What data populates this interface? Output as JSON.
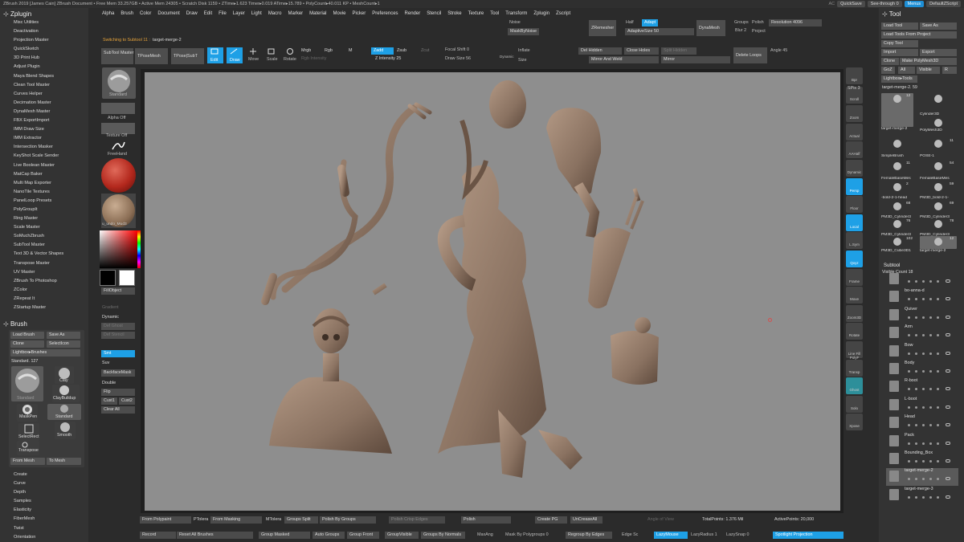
{
  "titlebar": {
    "text": "ZBrush 2019 [James Cain]   ZBrush Document     • Free Mem 33.257GB • Active Mem 24305 • Scratch Disk 1159 • ZTime▸1.623 Timer▸0.019 ATime▸15.789 • PolyCount▸40.011 KP  • MeshCount▸1",
    "ac": "AC",
    "quicksave": "QuickSave",
    "see_through": "See-through 0",
    "menus": "Menus",
    "default_zscript": "DefaultZScript"
  },
  "menubar": [
    "Alpha",
    "Brush",
    "Color",
    "Document",
    "Draw",
    "Edit",
    "File",
    "Layer",
    "Light",
    "Macro",
    "Marker",
    "Material",
    "Movie",
    "Picker",
    "Preferences",
    "Render",
    "Stencil",
    "Stroke",
    "Texture",
    "Tool",
    "Transform",
    "Zplugin",
    "Zscript"
  ],
  "left": {
    "title": "Zplugin",
    "plugins": [
      "Misc Utilities",
      "Deactivation",
      "Projection Master",
      "QuickSketch",
      "3D Print Hub",
      "Adjust Plugin",
      "Maya Blend Shapes",
      "Clean Tool Master",
      "Curves Helper",
      "Decimation Master",
      "DynaMesh Master",
      "FBX ExportImport",
      "IMM Draw Size",
      "IMM Extractor",
      "Intersection Masker",
      "KeyShot Scale Sender",
      "Live Boolean Master",
      "MatCap Baker",
      "Multi Map Exporter",
      "NanoTile Textures",
      "PanelLoop Presets",
      "PolyGroupIt",
      "Ring Master",
      "Scale Master",
      "SoMuchZbrush",
      "SubTool Master",
      "Text 3D & Vector Shapes",
      "Transpose Master",
      "UV Master",
      "ZBrush To Photoshop",
      "ZColor",
      "ZRepeat It",
      "ZStartup Master"
    ],
    "brush_title": "Brush",
    "brush": {
      "load": "Load Brush",
      "save_as": "Save As",
      "clone": "Clone",
      "select_icon": "SelectIcon",
      "lightbox": "Lightbox▸Brushes",
      "standard_count": "Standard. 127",
      "thumbs": [
        "Standard",
        "Clay",
        "ClayBuildup",
        "MaskPen",
        "Standard",
        "SelectRect",
        "Smooth",
        "Transpose"
      ],
      "from_mesh": "From Mesh",
      "to_mesh": "To Mesh"
    },
    "bottom": [
      "Create",
      "Curve",
      "Depth",
      "Samples",
      "Elasticity",
      "FiberMesh",
      "Twist",
      "Orientation"
    ]
  },
  "palette": {
    "standard": "Standard",
    "alpha_off": "Alpha Off",
    "texture_off": "Texture Off",
    "freehand": "FreeHand",
    "material": "u_undo_Mud3",
    "fill_object": "FillObject",
    "gradient": "Gradient",
    "dynamic": "Dynamic",
    "def_ghost": "Def Ghost",
    "def_stencil": "Def Stencil",
    "smt": "Smt",
    "suv": "Suv",
    "backface_mask": "BackfaceMask",
    "double": "Double",
    "flip": "Flip",
    "cust1": "Cust1",
    "cust2": "Cust2",
    "clear_all": "Clear All"
  },
  "toolbar": {
    "switching": "Switching to Subtool 11 :",
    "switching_target": "target-merge-2",
    "noise": "Noise",
    "mask_by_noise": "MaskByNoise",
    "zremesher": "ZRemesher",
    "half": "Half",
    "adapt": "Adapt",
    "adaptive_size": "AdaptiveSize 50",
    "dynamesh": "DynaMesh",
    "groups": "Groups",
    "polish": "Polish",
    "resolution": "Resolution 4096",
    "blur": "Blur 2",
    "project": "Project",
    "subtool_master": "SubTool Master",
    "tpose_mesh": "TPoseMesh",
    "tpose_subt": "TPose|SubT",
    "edit": "Edit",
    "draw": "Draw",
    "move": "Move",
    "scale": "Scale",
    "rotate": "Rotate",
    "mrgb": "Mrgb",
    "rgb": "Rgb",
    "m": "M",
    "rgb_intensity": "Rgb Intensity",
    "zadd": "Zadd",
    "zsub": "Zsub",
    "zcut": "Zcut",
    "z_intensity": "Z Intensity 25",
    "focal_shift": "Focal Shift 0",
    "draw_size": "Draw Size 56",
    "dynamic": "Dynamic",
    "inflate": "Inflate",
    "size": "Size",
    "del_hidden": "Del Hidden",
    "close_holes": "Close Holes",
    "split_hidden": "Split Hidden",
    "mirror_weld": "Mirror And Weld",
    "mirror": "Mirror",
    "delete_loops": "Delete Loops",
    "angle": "Angle 45"
  },
  "bottombar1": [
    "From Polypaint",
    "From Masking",
    "Groups Split",
    "Polish By Groups",
    "Polish Crisp Edges",
    "Polish",
    "Create PG",
    "UnCreaseAll"
  ],
  "bottombar1_labels": {
    "tolerance": "PTolera",
    "mtolerance": "MTolera",
    "angle_of_view": "Angle of View",
    "total_points": "TotalPoints: 1.376 Mil",
    "active_points": "ActivePoints: 20,000"
  },
  "bottombar2": [
    "Record",
    "Reset All Brushes",
    "Group Masked",
    "Auto Groups",
    "Group Front",
    "GroupVisible",
    "Groups By Normals",
    "Regroup By Edges",
    "LazyMouse",
    "Spotlight Projection"
  ],
  "bottombar2_labels": {
    "maxang": "MaxAng",
    "mask_by_polygroups": "Mask By Polygroups 0",
    "edge_sc": "Edge Sc",
    "lazyradius": "LazyRadius 1",
    "lazysnap": "LazySnap 0"
  },
  "right_icons": [
    "Bpr",
    "Scroll",
    "Zoom",
    "Actual",
    "AAHalf",
    "Dynamic",
    "Persp",
    "Floor",
    "Local",
    "L.Sym",
    "Qxyz",
    "Frame",
    "Move",
    "Zoom3D",
    "Rotate",
    "Line Fill PolyF",
    "Transp",
    "Ghost",
    "Solo",
    "Xpose"
  ],
  "right_extra": {
    "spix": "SPix 3"
  },
  "tool": {
    "title": "Tool",
    "load_tool": "Load Tool",
    "save_as": "Save As",
    "load_from_project": "Load Tools From Project",
    "copy_tool": "Copy Tool",
    "import": "Import",
    "export": "Export",
    "clone": "Clone",
    "make_polymesh": "Make PolyMesh3D",
    "goz": "GoZ",
    "all": "All",
    "visible": "Visible",
    "r": "R",
    "lightbox_tools": "Lightbox▸Tools",
    "current_tool": "target-merge-2.  59",
    "thumbs": [
      {
        "label": "target-merge-2",
        "num": "12"
      },
      {
        "label": "Cylinder3D",
        "num": ""
      },
      {
        "label": "PolyMesh3D",
        "num": ""
      },
      {
        "label": "SimpleBrush",
        "num": ""
      },
      {
        "label": "POSE-1",
        "num": "11"
      },
      {
        "label": "FemaleBaseMes",
        "num": "11"
      },
      {
        "label": "FemaleBaseMes",
        "num": "54"
      },
      {
        "label": "-bold-2-1-head",
        "num": "2"
      },
      {
        "label": "PM3D_bold-2-1-",
        "num": "59"
      },
      {
        "label": "PM3D_Cylinder3",
        "num": "68"
      },
      {
        "label": "PM3D_Cylinder3",
        "num": "69"
      },
      {
        "label": "PM3D_Cylinder3",
        "num": "76"
      },
      {
        "label": "PM3D_Cylinder3",
        "num": "78"
      },
      {
        "label": "PM3D_Cube3D1",
        "num": "102"
      },
      {
        "label": "target-merge-2",
        "num": "12"
      }
    ],
    "subtool_title": "Subtool",
    "visible_count": "Visible Count 18",
    "subtools": [
      "",
      "bo-anna-d",
      "Quiver",
      "Arm",
      "Bow",
      "Body",
      "R-boot",
      "L-boot",
      "Head",
      "Pack",
      "Bounding_Box",
      "target-merge-2",
      "target-merge-3"
    ]
  }
}
